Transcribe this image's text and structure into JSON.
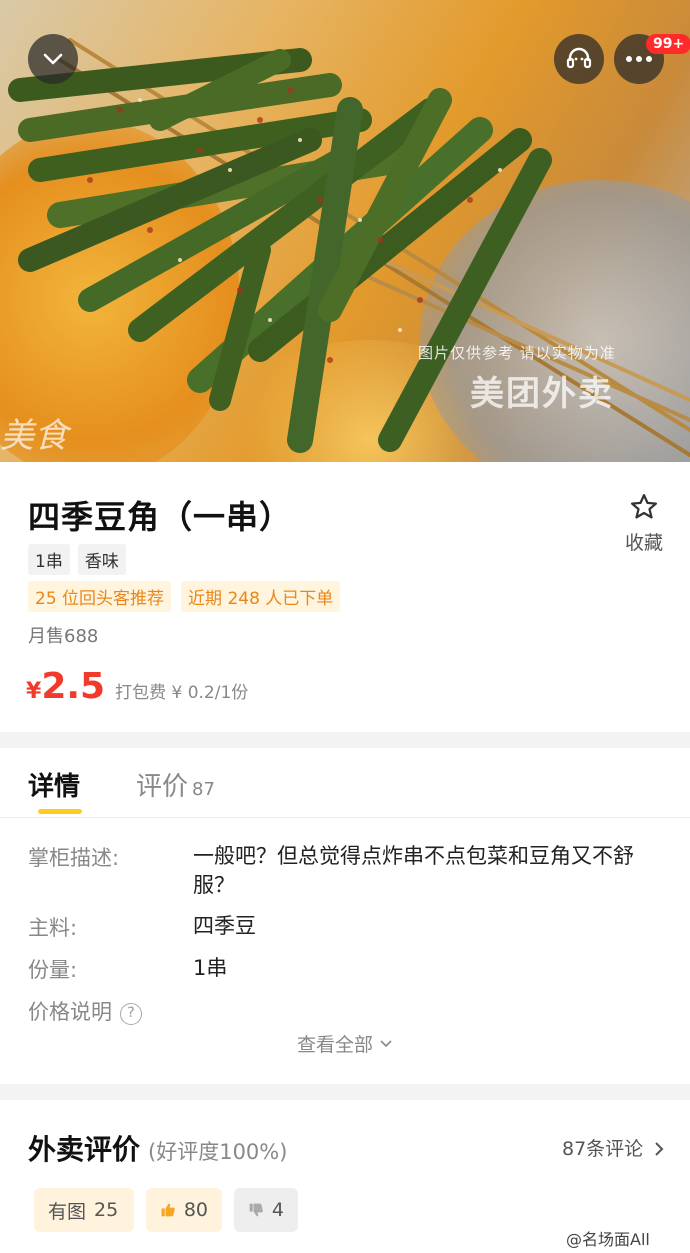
{
  "hero": {
    "watermark_note": "图片仅供参考 请以实物为准",
    "watermark_brand": "美团外卖",
    "watermark_corner": "美食",
    "cart_badge": "99+"
  },
  "product": {
    "title": "四季豆角（一串）",
    "favorite_label": "收藏",
    "tags": [
      "1串",
      "香味"
    ],
    "promos": [
      "25 位回头客推荐",
      "近期 248 人已下单"
    ],
    "monthly_sales": "月售688",
    "currency": "¥",
    "price": "2.5",
    "packing_fee": "打包费 ¥ 0.2/1份"
  },
  "detail": {
    "tab_detail": "详情",
    "tab_review": "评价",
    "tab_review_count": "87",
    "rows": [
      {
        "key": "掌柜描述:",
        "value": "一般吧？但总觉得点炸串不点包菜和豆角又不舒服？"
      },
      {
        "key": "主料:",
        "value": "四季豆"
      },
      {
        "key": "份量:",
        "value": "1串"
      },
      {
        "key": "价格说明",
        "value": ""
      }
    ],
    "see_all": "查看全部"
  },
  "reviews": {
    "title": "外卖评价",
    "good_rate": "(好评度100%)",
    "count_link": "87条评论",
    "chip_with_image": "有图",
    "chip_with_image_count": "25",
    "chip_good_count": "80",
    "chip_bad_count": "4"
  },
  "weibo_watermark": "@名场面All",
  "colors": {
    "accent_yellow": "#ffcc1e",
    "price_red": "#f03a2c",
    "promo_orange": "#e9871a",
    "badge_red": "#ff2a2a"
  }
}
